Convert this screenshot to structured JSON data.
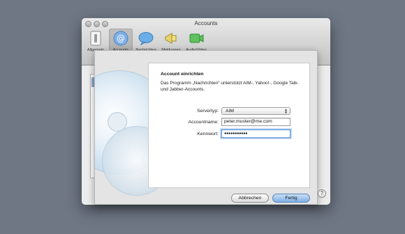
{
  "window": {
    "title": "Accounts",
    "traffic_lights": [
      "close",
      "minimize",
      "zoom"
    ]
  },
  "toolbar": {
    "items": [
      {
        "label": "Allgemein",
        "icon": "switch-icon"
      },
      {
        "label": "Accounts",
        "icon": "at-icon",
        "selected": true
      },
      {
        "label": "Nachrichten",
        "icon": "speech-bubble-icon"
      },
      {
        "label": "Meldungen",
        "icon": "megaphone-icon"
      },
      {
        "label": "Audio/Video",
        "icon": "video-camera-icon"
      }
    ]
  },
  "sheet": {
    "heading": "Account einrichten",
    "description": "Das Programm „Nachrichten“ unterstützt AIM-, Yahoo!-, Google Talk- und Jabber-Accounts.",
    "server_type_label": "Servertyp:",
    "server_type_value": "AIM",
    "account_label": "Accountname:",
    "account_value": "peter.muster@me.com",
    "password_label": "Kennwort:",
    "password_value": "●●●●●●●●●●●",
    "cancel_label": "Abbrechen",
    "done_label": "Fertig"
  },
  "help": {
    "label": "?"
  },
  "colors": {
    "desktop": "#6f7785",
    "primary_button": "#7fb1e6",
    "focus_ring": "#9cc3f0"
  }
}
